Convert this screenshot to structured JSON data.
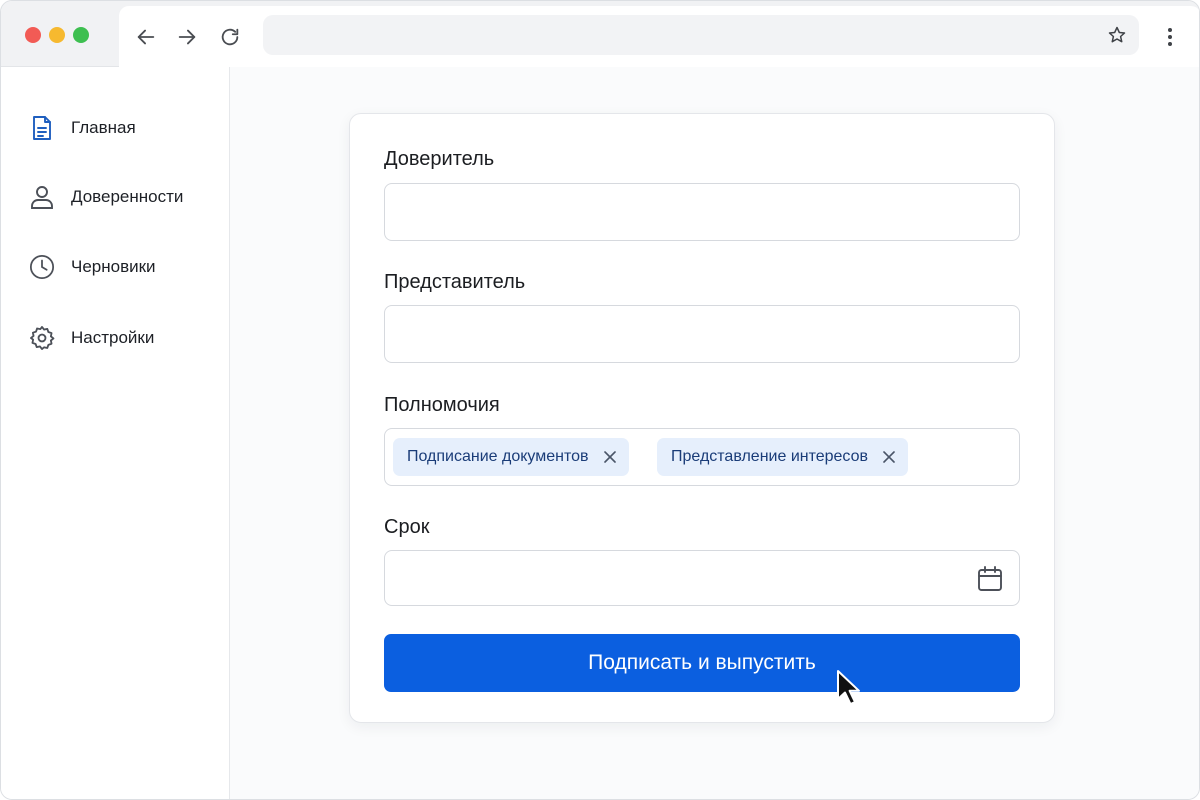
{
  "browser": {
    "traffic_lights": [
      "close",
      "minimize",
      "maximize"
    ],
    "nav_icons": [
      "arrow-left-icon",
      "arrow-right-icon",
      "reload-icon"
    ],
    "address_value": "",
    "bookmark_icon": "star-icon",
    "menu_icon": "kebab-menu-icon"
  },
  "sidebar": {
    "items": [
      {
        "label": "Главная",
        "icon": "document-icon",
        "active": true
      },
      {
        "label": "Доверенности",
        "icon": "user-icon"
      },
      {
        "label": "Черновики",
        "icon": "clock-icon"
      },
      {
        "label": "Настройки",
        "icon": "gear-icon"
      }
    ]
  },
  "form": {
    "principal": {
      "label": "Доверитель",
      "value": ""
    },
    "representative": {
      "label": "Представитель",
      "value": ""
    },
    "powers": {
      "label": "Полномочия",
      "chips": [
        "Подписание документов",
        "Представление интересов"
      ]
    },
    "term": {
      "label": "Срок",
      "value": "",
      "icon": "calendar-icon"
    },
    "submit_label": "Подписать и выпустить"
  },
  "colors": {
    "accent": "#0b5fe0",
    "chip_bg": "#e6effc",
    "chip_text": "#1a3c78",
    "active_icon": "#1f5fbf"
  }
}
